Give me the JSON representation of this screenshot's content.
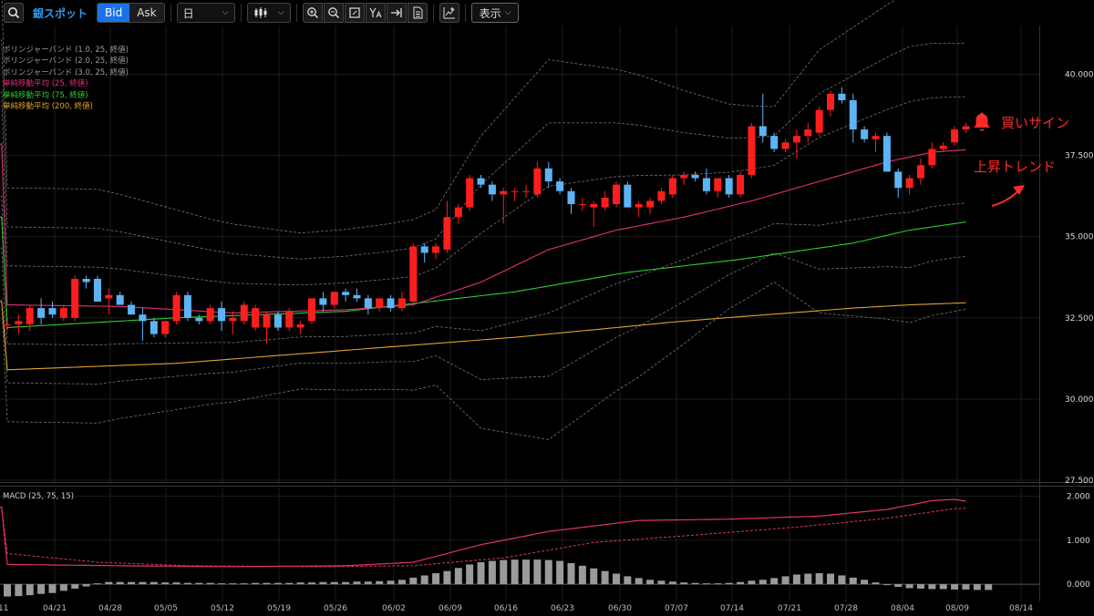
{
  "toolbar": {
    "symbol": "銀スポット",
    "bid_label": "Bid",
    "ask_label": "Ask",
    "period_value": "日",
    "display_label": "表示",
    "icons": [
      "search-icon",
      "candlestick-icon",
      "zoom-in-icon",
      "zoom-out-icon",
      "fit-icon",
      "text-y-icon",
      "jump-latest-icon",
      "document-icon",
      "add-indicator-icon"
    ]
  },
  "legend": [
    {
      "text": "ボリンジャーバンド (1.0, 25, 終値)",
      "color": "#9a9a9a"
    },
    {
      "text": "ボリンジャーバンド (2.0, 25, 終値)",
      "color": "#9a9a9a"
    },
    {
      "text": "ボリンジャーバンド (3.0, 25, 終値)",
      "color": "#9a9a9a"
    },
    {
      "text": "単純移動平均 (25, 終値)",
      "color": "#e0307a"
    },
    {
      "text": "単純移動平均 (75, 終値)",
      "color": "#2ecc2e"
    },
    {
      "text": "単純移動平均 (200, 終値)",
      "color": "#e0a030"
    }
  ],
  "annotations": {
    "signal": "買いサイン",
    "trend": "上昇トレンド"
  },
  "macd_label": "MACD (25, 75, 15)",
  "colors": {
    "up": "#ff1e1e",
    "down": "#5db4f5",
    "bb": "#8a8a8a",
    "sma25": "#e0307a",
    "sma75": "#2ecc2e",
    "sma200": "#e0a030",
    "macd": "#e0307a",
    "hist": "#9a9a9a"
  },
  "chart_data": [
    {
      "type": "candlestick",
      "ylim": [
        27.5,
        41.5
      ],
      "y_ticks": [
        "40.000",
        "37.500",
        "35.000",
        "32.500",
        "30.000",
        "27.500"
      ],
      "x_ticks": [
        "04/21",
        "04/28",
        "05/05",
        "05/12",
        "05/19",
        "05/26",
        "06/02",
        "06/09",
        "06/16",
        "06/23",
        "06/30",
        "07/07",
        "07/14",
        "07/21",
        "07/28",
        "08/04",
        "08/09",
        "08/14"
      ],
      "candles": [
        {
          "o": 32.3,
          "h": 32.5,
          "l": 32.1,
          "c": 32.3
        },
        {
          "o": 32.3,
          "h": 32.6,
          "l": 32.0,
          "c": 32.4
        },
        {
          "o": 32.3,
          "h": 32.9,
          "l": 32.1,
          "c": 32.8
        },
        {
          "o": 32.8,
          "h": 33.1,
          "l": 32.3,
          "c": 32.5
        },
        {
          "o": 32.8,
          "h": 33.0,
          "l": 32.5,
          "c": 32.6
        },
        {
          "o": 32.5,
          "h": 32.9,
          "l": 32.4,
          "c": 32.8
        },
        {
          "o": 32.5,
          "h": 33.8,
          "l": 32.4,
          "c": 33.7
        },
        {
          "o": 33.7,
          "h": 33.8,
          "l": 33.4,
          "c": 33.6
        },
        {
          "o": 33.7,
          "h": 33.8,
          "l": 33.0,
          "c": 33.0
        },
        {
          "o": 33.1,
          "h": 33.4,
          "l": 32.6,
          "c": 33.2
        },
        {
          "o": 33.2,
          "h": 33.3,
          "l": 32.9,
          "c": 32.9
        },
        {
          "o": 32.9,
          "h": 33.0,
          "l": 32.6,
          "c": 32.6
        },
        {
          "o": 32.6,
          "h": 32.8,
          "l": 31.8,
          "c": 32.4
        },
        {
          "o": 32.4,
          "h": 32.5,
          "l": 31.9,
          "c": 32.0
        },
        {
          "o": 32.0,
          "h": 32.4,
          "l": 31.9,
          "c": 32.4
        },
        {
          "o": 32.4,
          "h": 33.3,
          "l": 32.3,
          "c": 33.2
        },
        {
          "o": 33.2,
          "h": 33.3,
          "l": 32.4,
          "c": 32.5
        },
        {
          "o": 32.5,
          "h": 32.6,
          "l": 32.3,
          "c": 32.4
        },
        {
          "o": 32.4,
          "h": 32.9,
          "l": 32.3,
          "c": 32.8
        },
        {
          "o": 32.8,
          "h": 33.0,
          "l": 32.1,
          "c": 32.4
        },
        {
          "o": 32.4,
          "h": 32.7,
          "l": 32.0,
          "c": 32.5
        },
        {
          "o": 32.4,
          "h": 33.0,
          "l": 32.3,
          "c": 32.9
        },
        {
          "o": 32.2,
          "h": 32.9,
          "l": 32.1,
          "c": 32.8
        },
        {
          "o": 32.2,
          "h": 32.7,
          "l": 31.7,
          "c": 32.6
        },
        {
          "o": 32.6,
          "h": 32.7,
          "l": 32.1,
          "c": 32.2
        },
        {
          "o": 32.2,
          "h": 32.8,
          "l": 32.1,
          "c": 32.7
        },
        {
          "o": 32.2,
          "h": 32.4,
          "l": 32.0,
          "c": 32.3
        },
        {
          "o": 32.4,
          "h": 33.1,
          "l": 32.3,
          "c": 33.1
        },
        {
          "o": 33.1,
          "h": 33.3,
          "l": 32.7,
          "c": 32.9
        },
        {
          "o": 32.9,
          "h": 33.3,
          "l": 32.8,
          "c": 33.3
        },
        {
          "o": 33.3,
          "h": 33.4,
          "l": 33.0,
          "c": 33.2
        },
        {
          "o": 33.2,
          "h": 33.4,
          "l": 33.0,
          "c": 33.1
        },
        {
          "o": 33.1,
          "h": 33.2,
          "l": 32.6,
          "c": 32.8
        },
        {
          "o": 32.8,
          "h": 33.1,
          "l": 32.7,
          "c": 33.1
        },
        {
          "o": 33.1,
          "h": 33.2,
          "l": 32.7,
          "c": 32.8
        },
        {
          "o": 32.8,
          "h": 33.3,
          "l": 32.7,
          "c": 33.1
        },
        {
          "o": 33.0,
          "h": 34.8,
          "l": 32.9,
          "c": 34.7
        },
        {
          "o": 34.7,
          "h": 34.8,
          "l": 34.2,
          "c": 34.5
        },
        {
          "o": 34.5,
          "h": 34.8,
          "l": 34.3,
          "c": 34.7
        },
        {
          "o": 34.6,
          "h": 36.1,
          "l": 34.5,
          "c": 35.6
        },
        {
          "o": 35.6,
          "h": 36.0,
          "l": 35.4,
          "c": 35.9
        },
        {
          "o": 35.9,
          "h": 36.9,
          "l": 35.8,
          "c": 36.8
        },
        {
          "o": 36.8,
          "h": 36.9,
          "l": 36.5,
          "c": 36.6
        },
        {
          "o": 36.6,
          "h": 36.7,
          "l": 36.1,
          "c": 36.3
        },
        {
          "o": 36.3,
          "h": 36.5,
          "l": 35.4,
          "c": 36.4
        },
        {
          "o": 36.4,
          "h": 36.5,
          "l": 36.1,
          "c": 36.4
        },
        {
          "o": 36.4,
          "h": 36.6,
          "l": 36.2,
          "c": 36.4
        },
        {
          "o": 36.3,
          "h": 37.3,
          "l": 36.2,
          "c": 37.1
        },
        {
          "o": 37.1,
          "h": 37.3,
          "l": 36.5,
          "c": 36.7
        },
        {
          "o": 36.7,
          "h": 36.8,
          "l": 36.3,
          "c": 36.4
        },
        {
          "o": 36.4,
          "h": 36.5,
          "l": 35.7,
          "c": 36.0
        },
        {
          "o": 36.0,
          "h": 36.2,
          "l": 35.8,
          "c": 36.0
        },
        {
          "o": 35.9,
          "h": 36.1,
          "l": 35.3,
          "c": 36.0
        },
        {
          "o": 35.9,
          "h": 36.4,
          "l": 35.8,
          "c": 36.2
        },
        {
          "o": 36.0,
          "h": 36.7,
          "l": 35.9,
          "c": 36.6
        },
        {
          "o": 36.6,
          "h": 36.7,
          "l": 35.9,
          "c": 35.9
        },
        {
          "o": 35.9,
          "h": 36.1,
          "l": 35.6,
          "c": 36.0
        },
        {
          "o": 35.9,
          "h": 36.2,
          "l": 35.7,
          "c": 36.1
        },
        {
          "o": 36.1,
          "h": 36.5,
          "l": 36.0,
          "c": 36.4
        },
        {
          "o": 36.3,
          "h": 36.9,
          "l": 36.2,
          "c": 36.8
        },
        {
          "o": 36.8,
          "h": 37.0,
          "l": 36.6,
          "c": 36.9
        },
        {
          "o": 36.9,
          "h": 37.0,
          "l": 36.7,
          "c": 36.8
        },
        {
          "o": 36.8,
          "h": 37.1,
          "l": 36.3,
          "c": 36.4
        },
        {
          "o": 36.4,
          "h": 36.8,
          "l": 36.2,
          "c": 36.8
        },
        {
          "o": 36.8,
          "h": 36.9,
          "l": 36.2,
          "c": 36.3
        },
        {
          "o": 36.3,
          "h": 37.0,
          "l": 36.2,
          "c": 36.9
        },
        {
          "o": 36.9,
          "h": 38.5,
          "l": 36.8,
          "c": 38.4
        },
        {
          "o": 38.4,
          "h": 39.4,
          "l": 37.9,
          "c": 38.1
        },
        {
          "o": 38.1,
          "h": 38.2,
          "l": 37.6,
          "c": 37.7
        },
        {
          "o": 37.7,
          "h": 38.0,
          "l": 37.6,
          "c": 37.9
        },
        {
          "o": 37.9,
          "h": 38.3,
          "l": 37.4,
          "c": 38.1
        },
        {
          "o": 38.1,
          "h": 38.5,
          "l": 37.9,
          "c": 38.3
        },
        {
          "o": 38.2,
          "h": 39.0,
          "l": 38.1,
          "c": 38.9
        },
        {
          "o": 38.9,
          "h": 39.5,
          "l": 38.7,
          "c": 39.4
        },
        {
          "o": 39.4,
          "h": 39.6,
          "l": 39.1,
          "c": 39.2
        },
        {
          "o": 39.2,
          "h": 39.4,
          "l": 37.9,
          "c": 38.3
        },
        {
          "o": 38.3,
          "h": 38.4,
          "l": 37.9,
          "c": 38.0
        },
        {
          "o": 38.0,
          "h": 38.2,
          "l": 37.6,
          "c": 38.1
        },
        {
          "o": 38.1,
          "h": 38.2,
          "l": 37.0,
          "c": 37.0
        },
        {
          "o": 37.0,
          "h": 37.1,
          "l": 36.2,
          "c": 36.5
        },
        {
          "o": 36.5,
          "h": 36.9,
          "l": 36.3,
          "c": 36.8
        },
        {
          "o": 36.8,
          "h": 37.4,
          "l": 36.6,
          "c": 37.2
        },
        {
          "o": 37.2,
          "h": 37.9,
          "l": 37.1,
          "c": 37.7
        },
        {
          "o": 37.7,
          "h": 37.9,
          "l": 37.6,
          "c": 37.8
        },
        {
          "o": 37.9,
          "h": 38.4,
          "l": 37.8,
          "c": 38.3
        },
        {
          "o": 38.3,
          "h": 38.5,
          "l": 38.2,
          "c": 38.4
        }
      ],
      "sma25_anchors": [
        [
          0,
          32.9
        ],
        [
          10,
          32.85
        ],
        [
          20,
          32.65
        ],
        [
          30,
          32.75
        ],
        [
          36,
          32.9
        ],
        [
          42,
          33.6
        ],
        [
          48,
          34.6
        ],
        [
          54,
          35.2
        ],
        [
          60,
          35.6
        ],
        [
          66,
          36.1
        ],
        [
          72,
          36.7
        ],
        [
          78,
          37.3
        ],
        [
          82,
          37.6
        ],
        [
          86,
          37.7
        ],
        [
          88,
          37.85
        ]
      ],
      "sma75_anchors": [
        [
          0,
          32.2
        ],
        [
          15,
          32.5
        ],
        [
          30,
          32.7
        ],
        [
          45,
          33.3
        ],
        [
          55,
          33.9
        ],
        [
          65,
          34.3
        ],
        [
          75,
          34.8
        ],
        [
          80,
          35.2
        ],
        [
          88,
          35.6
        ]
      ],
      "sma200_anchors": [
        [
          0,
          30.9
        ],
        [
          15,
          31.1
        ],
        [
          30,
          31.5
        ],
        [
          45,
          31.9
        ],
        [
          60,
          32.4
        ],
        [
          75,
          32.8
        ],
        [
          80,
          32.9
        ],
        [
          88,
          33.0
        ]
      ],
      "bb_sigma_anchors": [
        [
          0,
          1.2
        ],
        [
          8,
          1.2
        ],
        [
          18,
          0.95
        ],
        [
          26,
          0.8
        ],
        [
          34,
          0.85
        ],
        [
          38,
          0.9
        ],
        [
          42,
          1.5
        ],
        [
          48,
          1.95
        ],
        [
          56,
          1.55
        ],
        [
          64,
          1.05
        ],
        [
          68,
          0.9
        ],
        [
          72,
          1.35
        ],
        [
          80,
          1.7
        ],
        [
          88,
          1.6
        ]
      ]
    },
    {
      "type": "macd",
      "ylim": [
        -0.35,
        2.2
      ],
      "y_ticks": [
        "2.000",
        "1.000",
        "0.000"
      ],
      "macd_anchors": [
        [
          0,
          0.45
        ],
        [
          10,
          0.42
        ],
        [
          20,
          0.4
        ],
        [
          30,
          0.42
        ],
        [
          36,
          0.5
        ],
        [
          42,
          0.9
        ],
        [
          48,
          1.2
        ],
        [
          56,
          1.45
        ],
        [
          64,
          1.48
        ],
        [
          72,
          1.55
        ],
        [
          78,
          1.7
        ],
        [
          82,
          1.9
        ],
        [
          84,
          1.93
        ],
        [
          86,
          1.85
        ],
        [
          88,
          1.75
        ]
      ],
      "signal_anchors": [
        [
          0,
          0.7
        ],
        [
          8,
          0.5
        ],
        [
          16,
          0.42
        ],
        [
          28,
          0.4
        ],
        [
          36,
          0.42
        ],
        [
          44,
          0.6
        ],
        [
          52,
          0.95
        ],
        [
          60,
          1.1
        ],
        [
          70,
          1.3
        ],
        [
          78,
          1.5
        ],
        [
          84,
          1.72
        ],
        [
          88,
          1.75
        ]
      ],
      "histogram": [
        -0.28,
        -0.27,
        -0.25,
        -0.22,
        -0.2,
        -0.15,
        -0.1,
        -0.05,
        0.02,
        0.05,
        0.05,
        0.05,
        0.05,
        0.05,
        0.04,
        0.04,
        0.03,
        0.03,
        0.03,
        0.02,
        0.02,
        0.02,
        0.03,
        0.03,
        0.03,
        0.03,
        0.04,
        0.04,
        0.05,
        0.05,
        0.05,
        0.06,
        0.06,
        0.07,
        0.08,
        0.1,
        0.15,
        0.2,
        0.25,
        0.3,
        0.37,
        0.45,
        0.5,
        0.53,
        0.55,
        0.56,
        0.56,
        0.56,
        0.55,
        0.53,
        0.48,
        0.42,
        0.36,
        0.3,
        0.24,
        0.18,
        0.14,
        0.1,
        0.08,
        0.06,
        0.04,
        0.03,
        0.02,
        0.02,
        0.03,
        0.05,
        0.08,
        0.1,
        0.14,
        0.18,
        0.22,
        0.24,
        0.25,
        0.24,
        0.2,
        0.15,
        0.1,
        0.04,
        -0.02,
        -0.06,
        -0.09,
        -0.1,
        -0.11,
        -0.11,
        -0.12,
        -0.12,
        -0.13,
        -0.13
      ]
    }
  ]
}
